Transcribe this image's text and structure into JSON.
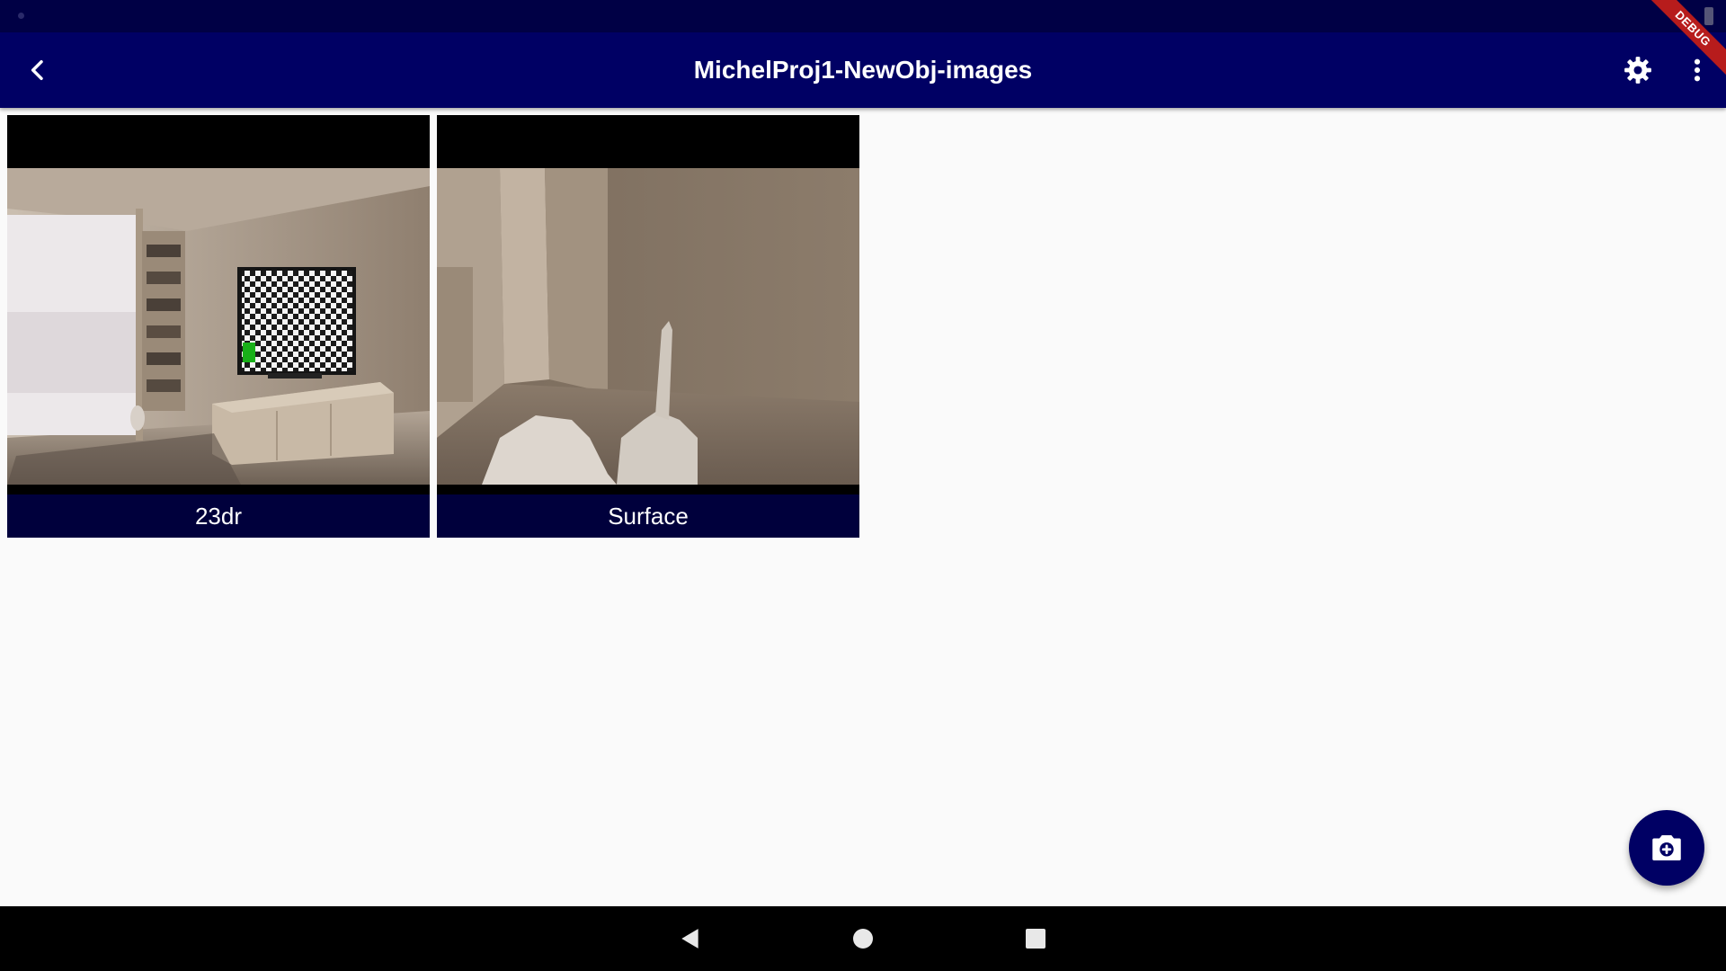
{
  "app_bar": {
    "title": "MichelProj1-NewObj-images"
  },
  "debug_banner": {
    "label": "DEBUG"
  },
  "images": [
    {
      "label": "23dr"
    },
    {
      "label": "Surface"
    }
  ],
  "icons": {
    "back": "chevron-left-icon",
    "settings": "gear-icon",
    "more": "more-vertical-icon",
    "fab": "camera-icon",
    "nav_back": "triangle-back-icon",
    "nav_home": "circle-home-icon",
    "nav_recents": "square-recents-icon"
  },
  "colors": {
    "app_bar": "#000064",
    "status_bar": "#000045",
    "label_bar": "#00003c",
    "background": "#fafafa",
    "debug_ribbon": "#b71c1c"
  }
}
